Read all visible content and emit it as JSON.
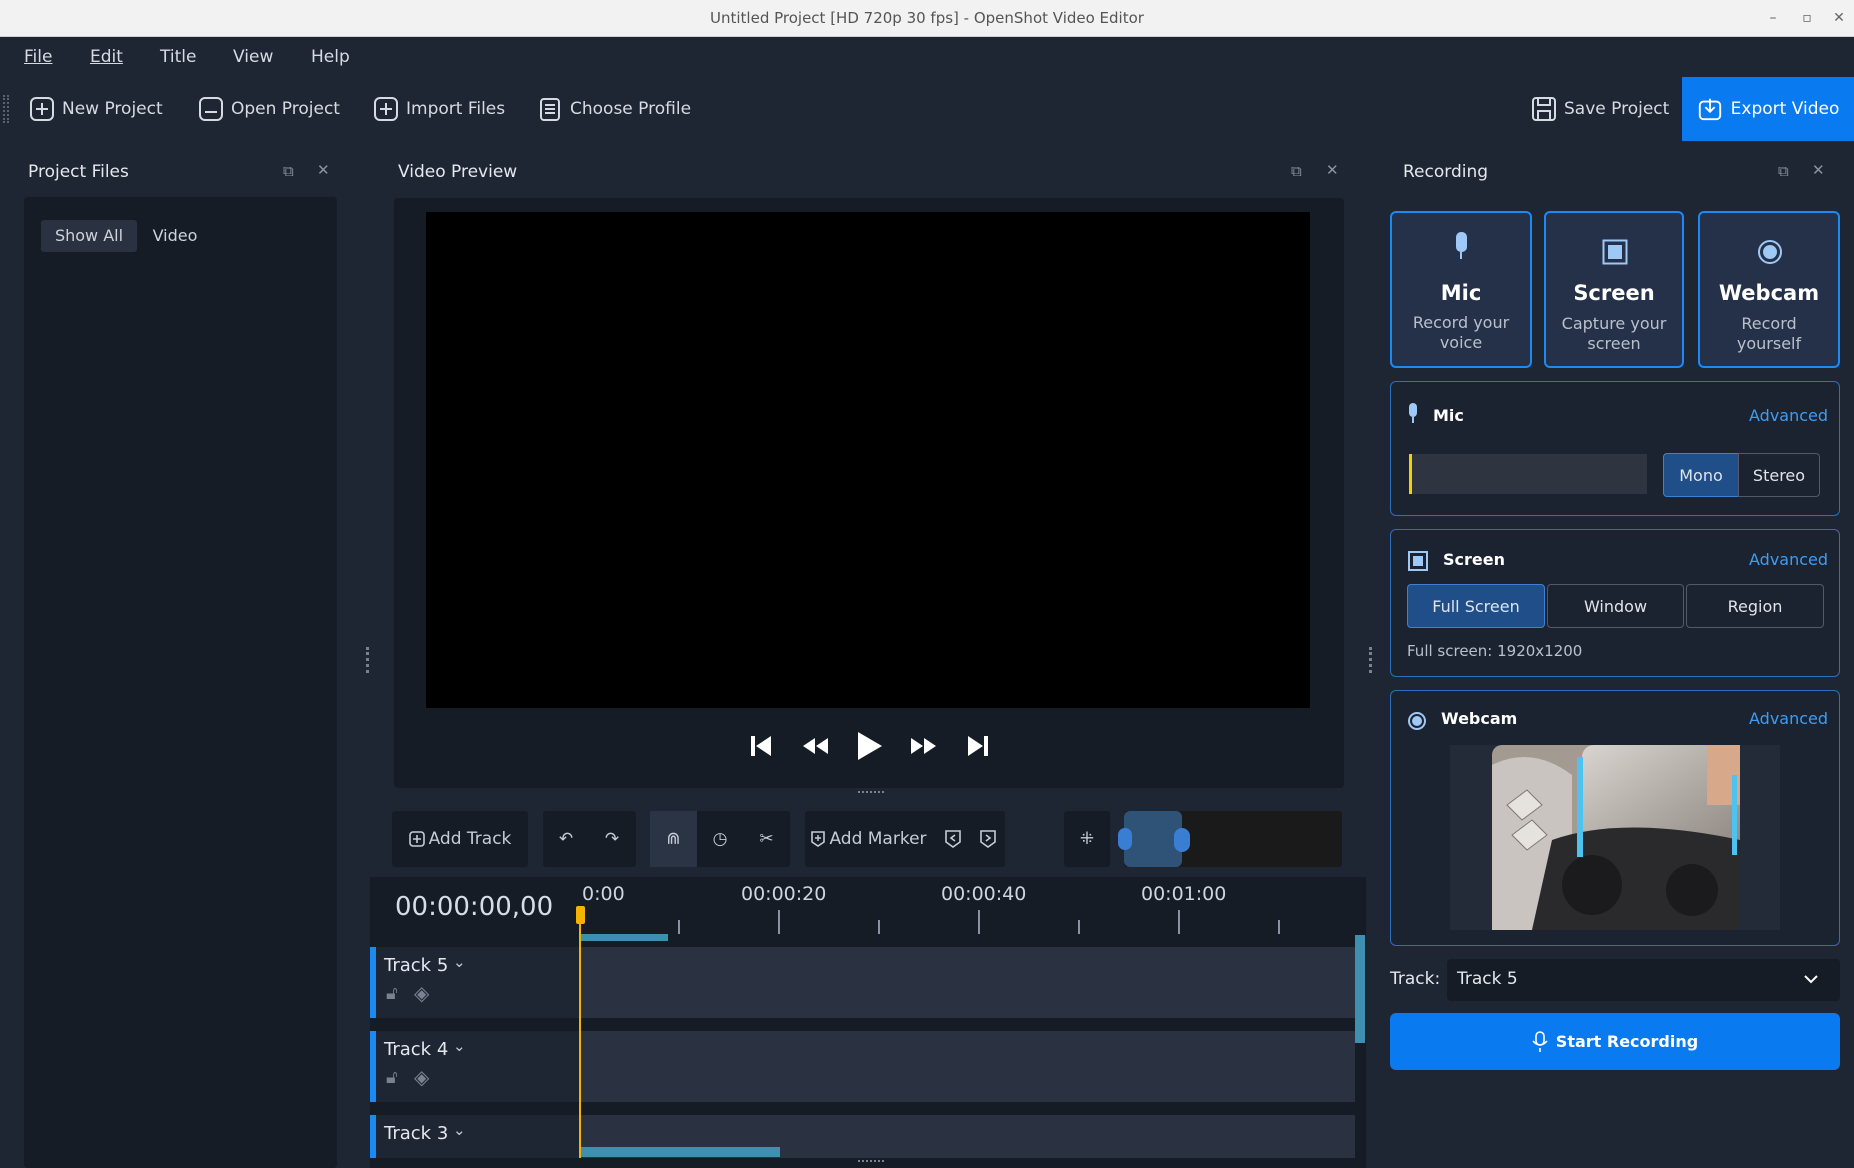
{
  "window": {
    "title": "Untitled Project [HD 720p 30 fps] - OpenShot Video Editor"
  },
  "menu": {
    "file": "File",
    "edit": "Edit",
    "title": "Title",
    "view": "View",
    "help": "Help"
  },
  "toolbar": {
    "new_project": "New Project",
    "open_project": "Open Project",
    "import_files": "Import Files",
    "choose_profile": "Choose Profile",
    "save_project": "Save Project",
    "export_video": "Export Video"
  },
  "project_files": {
    "title": "Project Files",
    "tabs": [
      "Show All",
      "Video"
    ]
  },
  "video_preview": {
    "title": "Video Preview"
  },
  "timeline": {
    "add_track": "Add Track",
    "add_marker": "Add Marker",
    "timecode": "00:00:00,00",
    "ruler": [
      "0:00",
      "00:00:20",
      "00:00:40",
      "00:01:00"
    ],
    "tracks": [
      {
        "name": "Track 5"
      },
      {
        "name": "Track 4"
      },
      {
        "name": "Track 3"
      }
    ]
  },
  "recording": {
    "title": "Recording",
    "cards": [
      {
        "title": "Mic",
        "line1": "Record your",
        "line2": "voice"
      },
      {
        "title": "Screen",
        "line1": "Capture your",
        "line2": "screen"
      },
      {
        "title": "Webcam",
        "line1": "Record",
        "line2": "yourself"
      }
    ],
    "mic": {
      "title": "Mic",
      "advanced": "Advanced",
      "mono": "Mono",
      "stereo": "Stereo"
    },
    "screen": {
      "title": "Screen",
      "advanced": "Advanced",
      "full_screen": "Full Screen",
      "window": "Window",
      "region": "Region",
      "info": "Full screen: 1920x1200"
    },
    "webcam": {
      "title": "Webcam",
      "advanced": "Advanced"
    },
    "track_label": "Track:",
    "track_value": "Track 5",
    "start": "Start Recording"
  },
  "colors": {
    "accent": "#0a7af0",
    "playhead": "#f5b301"
  }
}
